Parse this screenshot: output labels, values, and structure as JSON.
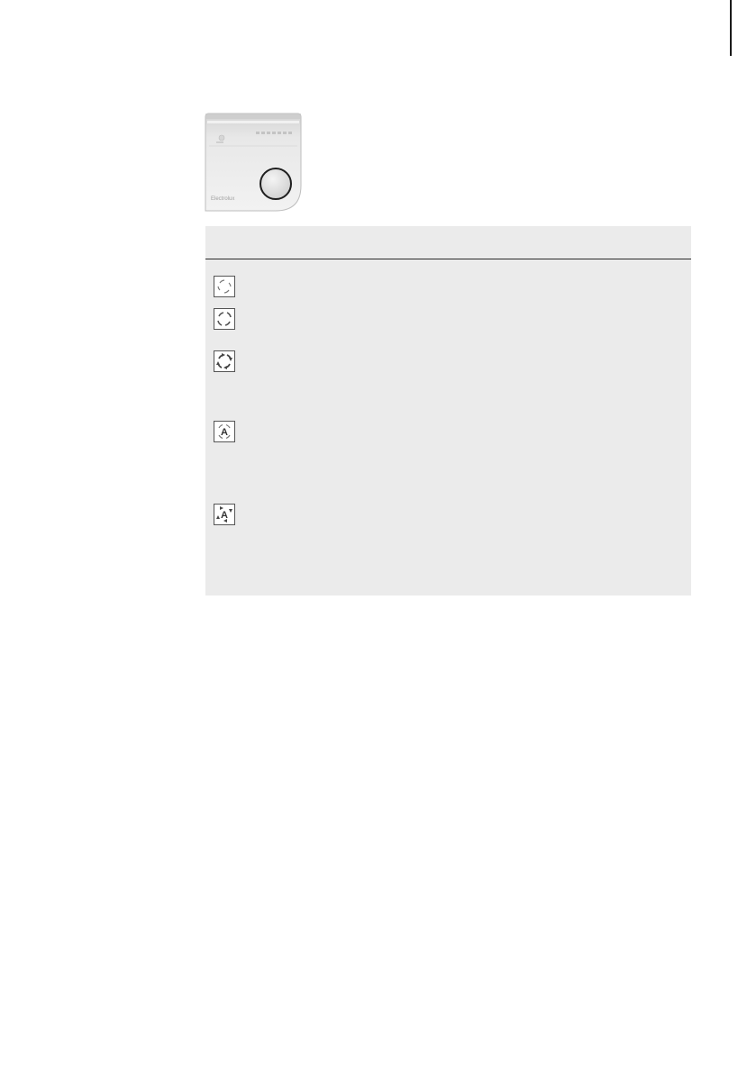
{
  "device": {
    "brand_label": "Electrolux",
    "button": "button"
  },
  "panel": {
    "header_text": "",
    "rows": [
      {
        "icon": "fan-low-icon",
        "text": ""
      },
      {
        "icon": "fan-medium-icon",
        "text": ""
      },
      {
        "icon": "fan-high-icon",
        "text": ""
      },
      {
        "icon": "fan-auto-icon",
        "letter": "A",
        "text": ""
      },
      {
        "icon": "fan-auto-boost-icon",
        "letter": "A",
        "text": ""
      }
    ]
  },
  "colors": {
    "panel_bg": "#ebebeb",
    "rule": "#2a2a2a",
    "page_edge": "#1a1a1a"
  }
}
